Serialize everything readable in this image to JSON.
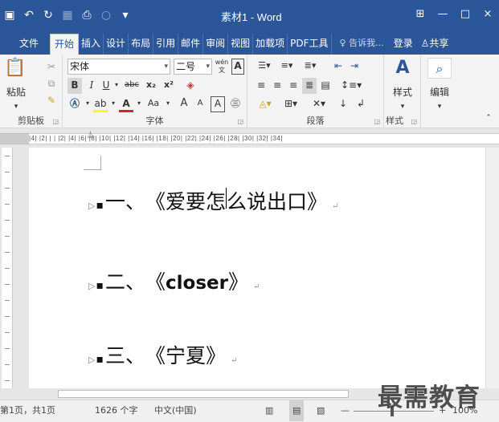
{
  "window": {
    "title": "素材1 - Word",
    "restore_icon": "ribbon-display-icon",
    "minimize_symbol": "—",
    "maximize_symbol": "□",
    "close_symbol": "×"
  },
  "colors": {
    "accent": "#2b579a",
    "ribbon": "#f3f3f3",
    "page": "#ffffff"
  },
  "tabs": [
    {
      "label": "文件",
      "active": false
    },
    {
      "label": "开始",
      "active": true
    },
    {
      "label": "插入",
      "active": false
    },
    {
      "label": "设计",
      "active": false
    },
    {
      "label": "布局",
      "active": false
    },
    {
      "label": "引用",
      "active": false
    },
    {
      "label": "邮件",
      "active": false
    },
    {
      "label": "审阅",
      "active": false
    },
    {
      "label": "视图",
      "active": false
    },
    {
      "label": "加载项",
      "active": false
    },
    {
      "label": "PDF工具",
      "active": false
    }
  ],
  "tellme": "告诉我...",
  "login": "登录",
  "share": "共享",
  "ribbon": {
    "clipboard": {
      "paste_label": "粘贴",
      "group_label": "剪贴板"
    },
    "font": {
      "font_name": "宋体",
      "font_size": "二号",
      "group_label": "字体",
      "phonetic": "wén 文",
      "border_char": "A",
      "bold": "B",
      "italic": "I",
      "underline": "U",
      "strike": "abc",
      "subscript": "x₂",
      "superscript": "x²",
      "change_case": "Aa",
      "grow": "A",
      "shrink": "A"
    },
    "paragraph": {
      "group_label": "段落"
    },
    "styles": {
      "button_label": "样式",
      "group_label": "样式"
    },
    "editing": {
      "button_label": "编辑"
    }
  },
  "ruler_text": "|4| |2| |  | |2| |4| |6| |8| |10| |12| |14| |16| |18| |20| |22| |24| |26| |28| |30| |32| |34|",
  "document": {
    "paragraphs": [
      {
        "number": "一、",
        "open": "《",
        "title_before_cursor": "爱要怎",
        "title_after_cursor": "么说出口",
        "close": " 》",
        "bold": false
      },
      {
        "number": "二、",
        "open": "《",
        "title": "closer",
        "close": " 》",
        "bold": true
      },
      {
        "number": "三、",
        "open": "《",
        "title": "宁夏",
        "close": " 》",
        "bold": false
      }
    ]
  },
  "status": {
    "page": "第1页，共1页",
    "words": "1626 个字",
    "language": "中文(中国)",
    "zoom": "100%"
  },
  "watermark": "最需教育"
}
